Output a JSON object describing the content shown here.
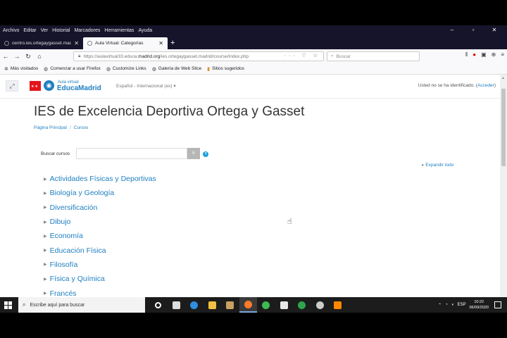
{
  "menu": [
    "Archivo",
    "Editar",
    "Ver",
    "Historial",
    "Marcadores",
    "Herramientas",
    "Ayuda"
  ],
  "window_controls": [
    "–",
    "▫",
    "✕"
  ],
  "tabs": [
    {
      "label": "centro.ies.ortegaygasset.madr",
      "active": false
    },
    {
      "label": "Aula Virtual: Categorías",
      "active": true
    }
  ],
  "new_tab": "+",
  "nav": {
    "url_prefix": "https://aulavirtual33.educa.",
    "url_domain": "madrid.org",
    "url_suffix": "/ies.ortegaygasset.madrid/course/index.php",
    "url_icons": "··· ♡ ☆",
    "search_placeholder": "Buscar"
  },
  "bookmarks": [
    "Más visitados",
    "Comenzar a usar Firefox",
    "Customize Links",
    "Galería de Web Slice",
    "Sitios sugeridos"
  ],
  "site": {
    "logo_small": "Aula virtual",
    "logo_big": "EducaMadrid",
    "flag_text": "★★",
    "language": "Español - Internacional (es)",
    "login_text": "Usted no se ha identificado. (",
    "login_link": "Acceder",
    "login_close": ")"
  },
  "page": {
    "title": "IES de Excelencia Deportiva Ortega y Gasset",
    "breadcrumbs": [
      "Página Principal",
      "Cursos"
    ],
    "search_label": "Buscar cursos",
    "search_value": "",
    "search_button": "Ir",
    "help": "?",
    "expand_all": "Expandir todo"
  },
  "categories": [
    "Actividades Físicas y Deportivas",
    "Biología y Geología",
    "Diversificación",
    "Dibujo",
    "Economía",
    "Educación Física",
    "Filosofía",
    "Física y Química",
    "Francés"
  ],
  "taskbar": {
    "search_placeholder": "Escribe aquí para buscar",
    "lang": "ESP",
    "time": "10:22",
    "date": "06/09/2020",
    "apps": [
      {
        "name": "cortana",
        "color": "#ffffff"
      },
      {
        "name": "task-view",
        "color": "#dddddd"
      },
      {
        "name": "edge",
        "color": "#2f8ee0"
      },
      {
        "name": "file-explorer",
        "color": "#f0c040"
      },
      {
        "name": "media",
        "color": "#c8a060"
      },
      {
        "name": "firefox",
        "color": "#ff7a2a"
      },
      {
        "name": "chrome",
        "color": "#3cba54"
      },
      {
        "name": "store",
        "color": "#e8e8e8"
      },
      {
        "name": "app-green",
        "color": "#2ea44f"
      },
      {
        "name": "app-gray",
        "color": "#cccccc"
      },
      {
        "name": "vlc",
        "color": "#ff8800"
      }
    ]
  },
  "colors": {
    "link": "#1f7fc0",
    "brand_red": "#e4151d",
    "titlebar": "#15142a"
  }
}
